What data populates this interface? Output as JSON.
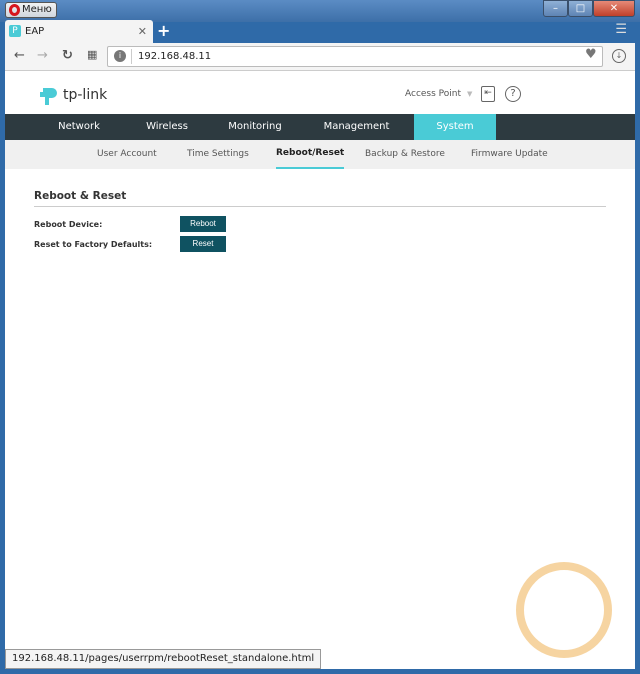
{
  "browser": {
    "menu_label": "Меню",
    "tab_title": "EAP",
    "tab_favicon": "P",
    "new_tab": "+",
    "url": "192.168.48.11",
    "status_url": "192.168.48.11/pages/userrpm/rebootReset_standalone.html"
  },
  "header": {
    "logo_text": "tp-link",
    "mode": "Access Point"
  },
  "main_nav": [
    {
      "label": "Network"
    },
    {
      "label": "Wireless"
    },
    {
      "label": "Monitoring"
    },
    {
      "label": "Management"
    },
    {
      "label": "System",
      "active": true
    }
  ],
  "sub_nav": [
    {
      "label": "User Account"
    },
    {
      "label": "Time Settings"
    },
    {
      "label": "Reboot/Reset",
      "active": true
    },
    {
      "label": "Backup & Restore"
    },
    {
      "label": "Firmware Update"
    }
  ],
  "content": {
    "title": "Reboot & Reset",
    "reboot_label": "Reboot Device:",
    "reboot_button": "Reboot",
    "reset_label": "Reset to Factory Defaults:",
    "reset_button": "Reset"
  },
  "colors": {
    "accent": "#4acbd6",
    "nav_bg": "#2d3a40",
    "button": "#0f5261"
  }
}
